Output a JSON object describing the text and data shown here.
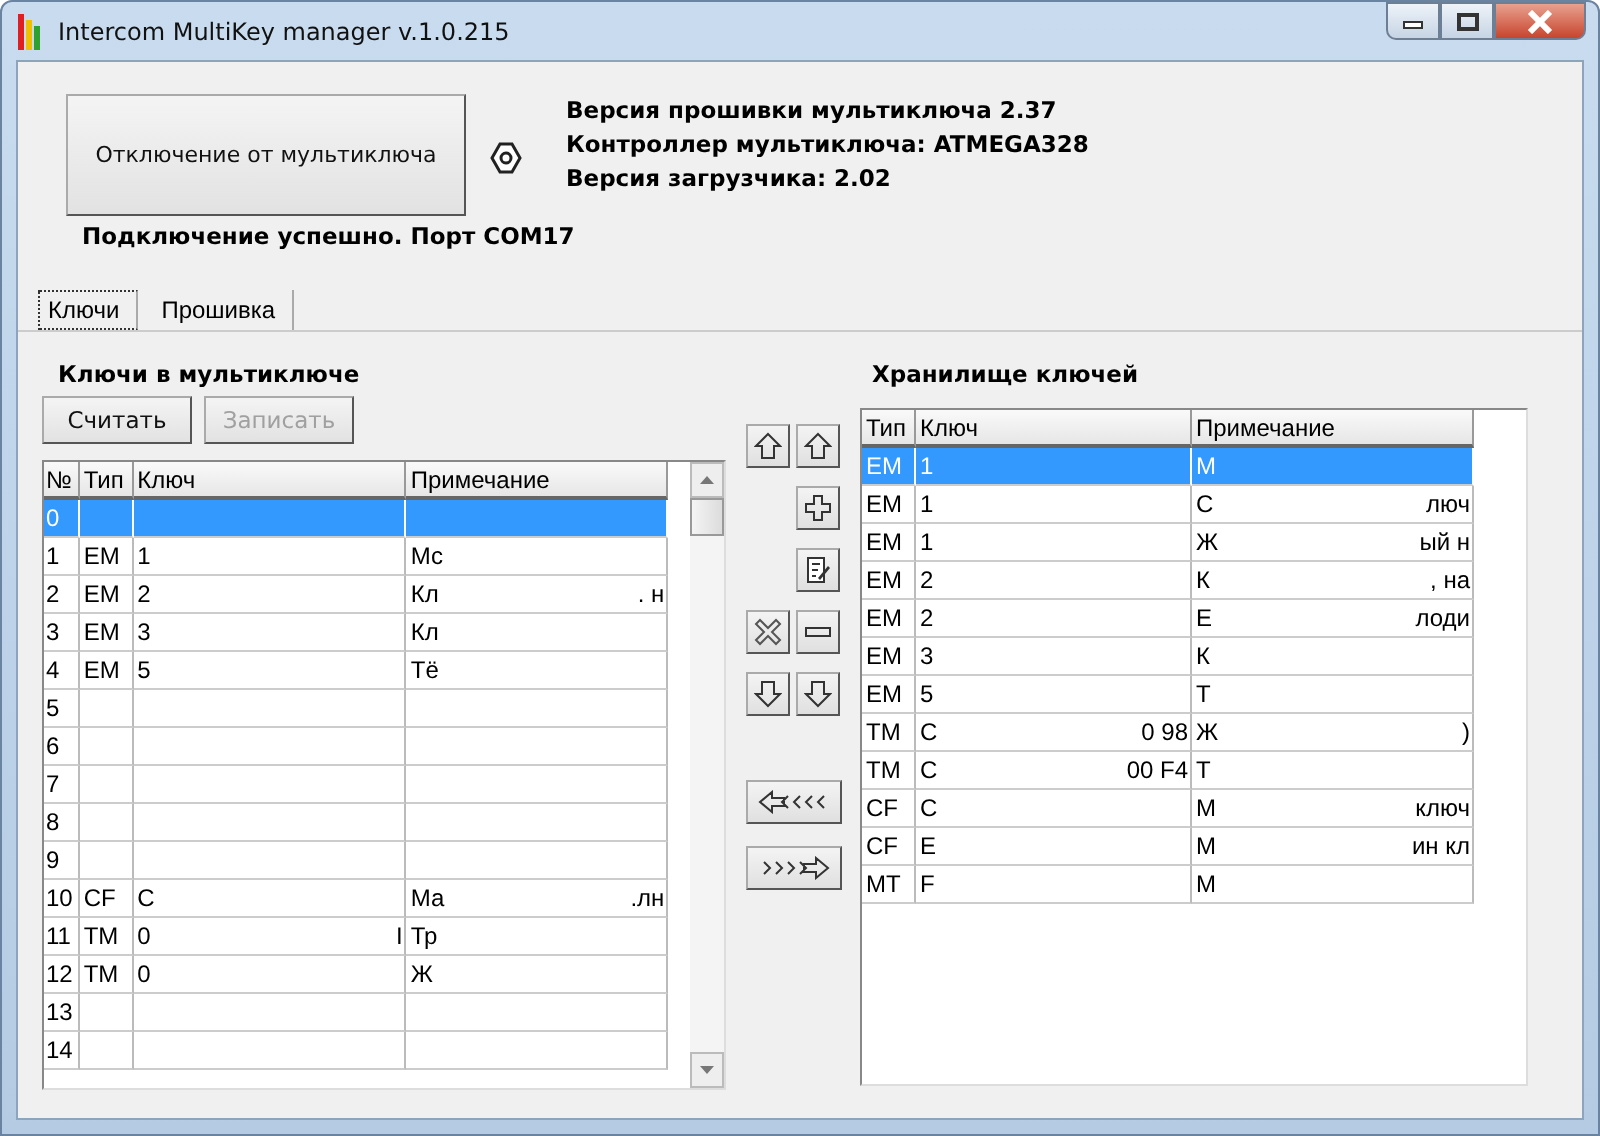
{
  "window": {
    "title": "Intercom MultiKey manager v.1.0.215"
  },
  "disconnect_button": "Отключение от мультиключа",
  "device_info": [
    "Версия прошивки мультиключа 2.37",
    "Контроллер мультиключа: ATMEGA328",
    "Версия загрузчика: 2.02"
  ],
  "status": "Подключение успешно. Порт COM17",
  "tabs": [
    {
      "label": "Ключи",
      "selected": true
    },
    {
      "label": "Прошивка",
      "selected": false
    }
  ],
  "multikey": {
    "title": "Ключи в мультиключе",
    "buttons": [
      {
        "label": "Считать",
        "disabled": false
      },
      {
        "label": "Записать",
        "disabled": true
      }
    ],
    "columns": [
      "№",
      "Тип",
      "Ключ",
      "Примечание"
    ],
    "rows": [
      {
        "num": "0",
        "selected": true
      },
      {
        "num": "1",
        "type": "EM",
        "key": "1",
        "note": "Мс",
        "selected": false
      },
      {
        "num": "2",
        "type": "EM",
        "key": "2",
        "note": "Кл",
        "note_end": ". н",
        "selected": false
      },
      {
        "num": "3",
        "type": "EM",
        "key": "3",
        "note": "Кл",
        "selected": false
      },
      {
        "num": "4",
        "type": "EM",
        "key": "5",
        "note": "Тё",
        "selected": false
      },
      {
        "num": "5",
        "selected": false
      },
      {
        "num": "6",
        "selected": false
      },
      {
        "num": "7",
        "selected": false
      },
      {
        "num": "8",
        "selected": false
      },
      {
        "num": "9",
        "selected": false
      },
      {
        "num": "10",
        "type": "CF",
        "key": "C",
        "note": "Ма",
        "note_end": ".лн",
        "selected": false
      },
      {
        "num": "11",
        "type": "TM",
        "key": "0",
        "key_end": "I",
        "note": "Тр",
        "selected": false
      },
      {
        "num": "12",
        "type": "TM",
        "key": "0",
        "note": "Ж",
        "selected": false
      },
      {
        "num": "13",
        "selected": false
      },
      {
        "num": "14",
        "selected": false
      }
    ]
  },
  "storage": {
    "title": "Хранилище ключей",
    "columns": [
      "Тип",
      "Ключ",
      "Примечание"
    ],
    "rows": [
      {
        "type": "EM",
        "key": "1",
        "note": "М",
        "selected": true
      },
      {
        "type": "EM",
        "key": "1",
        "note": "С",
        "note_end": "люч",
        "selected": false
      },
      {
        "type": "EM",
        "key": "1",
        "note": "Ж",
        "note_end": "ый н",
        "selected": false
      },
      {
        "type": "EM",
        "key": "2",
        "note": "К",
        "note_end": ", на",
        "selected": false
      },
      {
        "type": "EM",
        "key": "2",
        "note": "Е",
        "note_end": "лоди",
        "selected": false
      },
      {
        "type": "EM",
        "key": "3",
        "note": "К",
        "selected": false
      },
      {
        "type": "EM",
        "key": "5",
        "note": "Т",
        "selected": false
      },
      {
        "type": "TM",
        "key": "С",
        "key_end": "0 98",
        "note": "Ж",
        "note_end": ")",
        "selected": false
      },
      {
        "type": "TM",
        "key": "С",
        "key_end": "00 F4",
        "note": "Т",
        "selected": false
      },
      {
        "type": "CF",
        "key": "С",
        "note": "М",
        "note_end": "ключ",
        "selected": false
      },
      {
        "type": "CF",
        "key": "Е",
        "note": "М",
        "note_end": "ин кл",
        "selected": false
      },
      {
        "type": "MT",
        "key": "F",
        "note": "М",
        "selected": false
      }
    ]
  }
}
